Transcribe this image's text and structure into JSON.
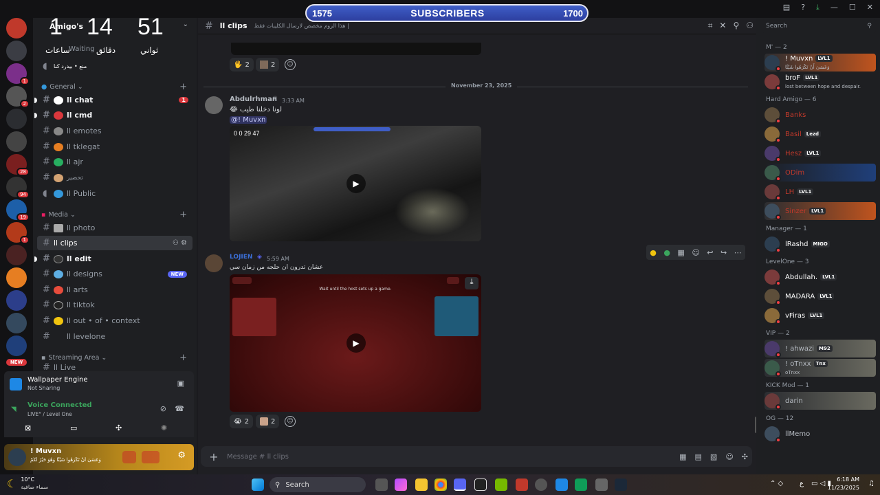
{
  "overlay": {
    "subs_current": "1575",
    "subs_label": "SUBSCRIBERS",
    "subs_goal": "1700",
    "countdown": {
      "hours": "1",
      "minutes": "14",
      "seconds": "51",
      "hours_label": "ساعات",
      "minutes_label": "دقائق",
      "seconds_label": "ثواني",
      "status": "Waiting"
    }
  },
  "server": {
    "name": "Amigo's",
    "rail_badges": [
      "1",
      "2",
      "28",
      "94",
      "19",
      "1"
    ],
    "rail_new": "NEW"
  },
  "sidebar": {
    "top_items": [
      {
        "label": "منع • بيدرد كنا"
      }
    ],
    "categories": [
      {
        "label": "General"
      },
      {
        "label": "Media"
      },
      {
        "label": "Streaming Area"
      }
    ],
    "channels_general": [
      {
        "label": "ll chat",
        "mention": "1"
      },
      {
        "label": "ll cmd"
      },
      {
        "label": "ll emotes"
      },
      {
        "label": "ll tklegat"
      },
      {
        "label": "ll ajr"
      },
      {
        "label": "تحضير"
      },
      {
        "label": "ll Public"
      }
    ],
    "channels_media": [
      {
        "label": "ll photo"
      },
      {
        "label": "ll clips"
      },
      {
        "label": "ll edit"
      },
      {
        "label": "ll designs",
        "tag": "NEW"
      },
      {
        "label": "ll arts"
      },
      {
        "label": "ll tiktok"
      },
      {
        "label": "ll out • of • context"
      },
      {
        "label": "ll levelone"
      }
    ],
    "streaming_partial": "ll Live"
  },
  "panels": {
    "wallpaper_title": "Wallpaper Engine",
    "wallpaper_sub": "Not Sharing",
    "voice_title": "Voice Connected",
    "voice_sub": "LIVE° / Level One",
    "user_name": "! Muvxn",
    "user_status": "وَعَسَىٰ أَنْ تَكْرَهُوا شَيْئًا وَهُوَ خَيْرٌ لَكُمْ"
  },
  "chat": {
    "channel": "ll clips",
    "topic": "هذا الروم مخصص لارسال الكليبات فقط |",
    "reactions_top": [
      {
        "count": "2"
      },
      {
        "count": "2"
      }
    ],
    "date_divider": "November 23, 2025",
    "messages": [
      {
        "author": "Abdulrhman",
        "author_color": "#b5bac1",
        "time": "3:33 AM",
        "text": "لونا دخلنا طيب",
        "mention": "@! Muvxn",
        "embed_counter": "0  0  29  47"
      },
      {
        "author": "LOJIEN",
        "author_color": "#3b6fd8",
        "time": "5:59 AM",
        "text": "عشان تدرون ان حلجه من زمان سي",
        "video_text": "Wait until the host sets up a game.",
        "reactions": [
          {
            "count": "2"
          },
          {
            "count": "2"
          }
        ]
      }
    ],
    "composer_placeholder": "Message # ll clips"
  },
  "members": {
    "search_placeholder": "Search",
    "groups": [
      {
        "label": "M' — 2",
        "items": [
          {
            "name": "! Muvxn",
            "tag": "LVL1",
            "sub": "وَعَسَىٰ أَنْ تَكْرَهُوا شَيْئًا",
            "color": "#ffffff"
          },
          {
            "name": "broF",
            "tag": "LVL1",
            "sub": "lost between hope and despair.",
            "color": "#ffffff"
          }
        ]
      },
      {
        "label": "Hard Amigo — 6",
        "items": [
          {
            "name": "Banks",
            "tag": "",
            "color": "#c0392b"
          },
          {
            "name": "Basil",
            "tag": "Lezd",
            "color": "#c0392b"
          },
          {
            "name": "Hesz",
            "tag": "LVL1",
            "color": "#c0392b"
          },
          {
            "name": "ODim",
            "tag": "",
            "color": "#c0392b"
          },
          {
            "name": "LH",
            "tag": "LVL1",
            "color": "#c0392b"
          },
          {
            "name": "Sinzer",
            "tag": "LVL1",
            "color": "#c0392b"
          }
        ]
      },
      {
        "label": "Manager — 1",
        "items": [
          {
            "name": "lRashd",
            "tag": "MIGO",
            "color": "#ffffff"
          }
        ]
      },
      {
        "label": "LevelOne — 3",
        "items": [
          {
            "name": "Abdullah.",
            "tag": "LVL1",
            "color": "#ffffff"
          },
          {
            "name": "MADARA",
            "tag": "LVL1",
            "color": "#ffffff"
          },
          {
            "name": "vFiras",
            "tag": "LVL1",
            "color": "#ffffff"
          }
        ]
      },
      {
        "label": "VIP — 2",
        "items": [
          {
            "name": "! ahwazi",
            "tag": "M92",
            "color": "#b5bac1"
          },
          {
            "name": "! oTnxx",
            "tag": "Tnx",
            "sub": "oTnxx",
            "color": "#b5bac1"
          }
        ]
      },
      {
        "label": "KICK Mod — 1",
        "items": [
          {
            "name": "darin",
            "tag": "",
            "color": "#b5bac1"
          }
        ]
      },
      {
        "label": "OG — 12",
        "items": [
          {
            "name": "llMemo",
            "tag": "",
            "color": "#b5bac1"
          }
        ]
      }
    ]
  },
  "taskbar": {
    "temp": "10°C",
    "weather": "سماء صافية",
    "search": "Search",
    "time": "6:18 AM",
    "date": "11/23/2025",
    "lang": "ع"
  }
}
